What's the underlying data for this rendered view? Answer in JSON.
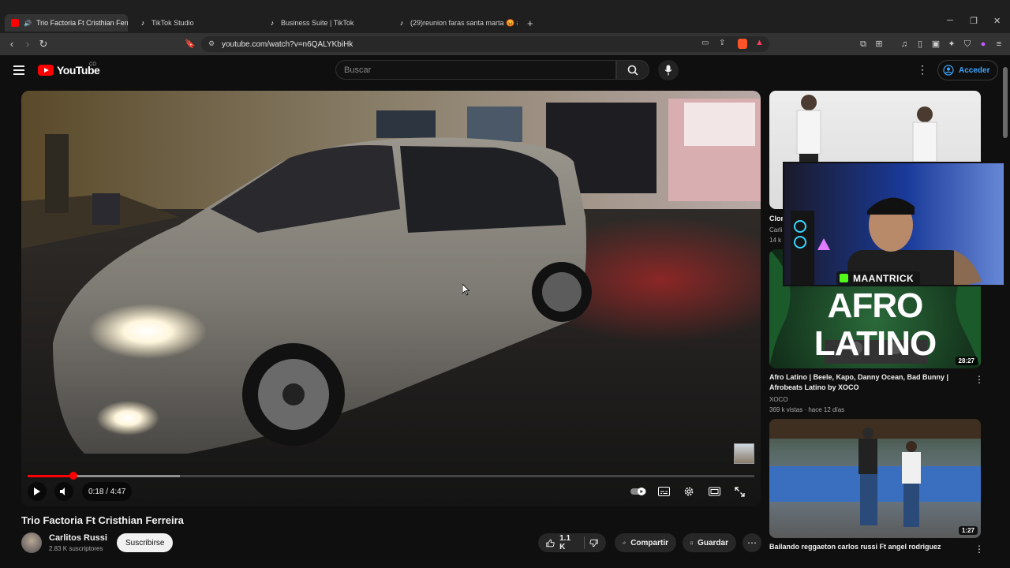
{
  "browser": {
    "tabs": [
      {
        "title": "Trio Factoria Ft Cristhian Ferre",
        "favicon": "youtube-icon",
        "active": true
      },
      {
        "title": "TikTok Studio",
        "favicon": "tiktok-icon",
        "active": false
      },
      {
        "title": "Business Suite | TikTok",
        "favicon": "tiktok-icon",
        "active": false
      },
      {
        "title": "(29)reunion faras santa marta 😡 #sa",
        "favicon": "tiktok-icon",
        "active": false
      }
    ],
    "new_tab_label": "+",
    "url": "youtube.com/watch?v=n6QALYKbiHk"
  },
  "header": {
    "logo_text": "YouTube",
    "country_code": "CO",
    "search_placeholder": "Buscar",
    "signin_label": "Acceder"
  },
  "player": {
    "time_display": "0:18 / 4:47",
    "progress_fraction": 0.063,
    "buffered_fraction": 0.21
  },
  "video": {
    "title": "Trio Factoria Ft Cristhian Ferreira",
    "channel_name": "Carlitos Russi",
    "channel_subs": "2.83 K suscriptores",
    "subscribe_label": "Suscribirse",
    "like_count": "1.1 K",
    "share_label": "Compartir",
    "save_label": "Guardar"
  },
  "sidebar": {
    "items": [
      {
        "title_partial": "Clon",
        "channel_partial": "Carli",
        "views_partial": "14 k"
      },
      {
        "thumb_text": "AFRO LATINO",
        "duration": "28:27",
        "title": "Afro Latino | Beele, Kapo, Danny Ocean, Bad Bunny | Afrobeats Latino by XOCO",
        "channel": "XOCO",
        "meta": "369 k vistas · hace 12 días"
      },
      {
        "duration": "1:27",
        "title": "Bailando reggaeton carlos russi Ft angel rodriguez"
      }
    ]
  },
  "webcam": {
    "streamer_name": "MAANTRICK"
  },
  "colors": {
    "accent_red": "#ff0000",
    "background": "#0f0f0f",
    "pill": "#272727"
  }
}
